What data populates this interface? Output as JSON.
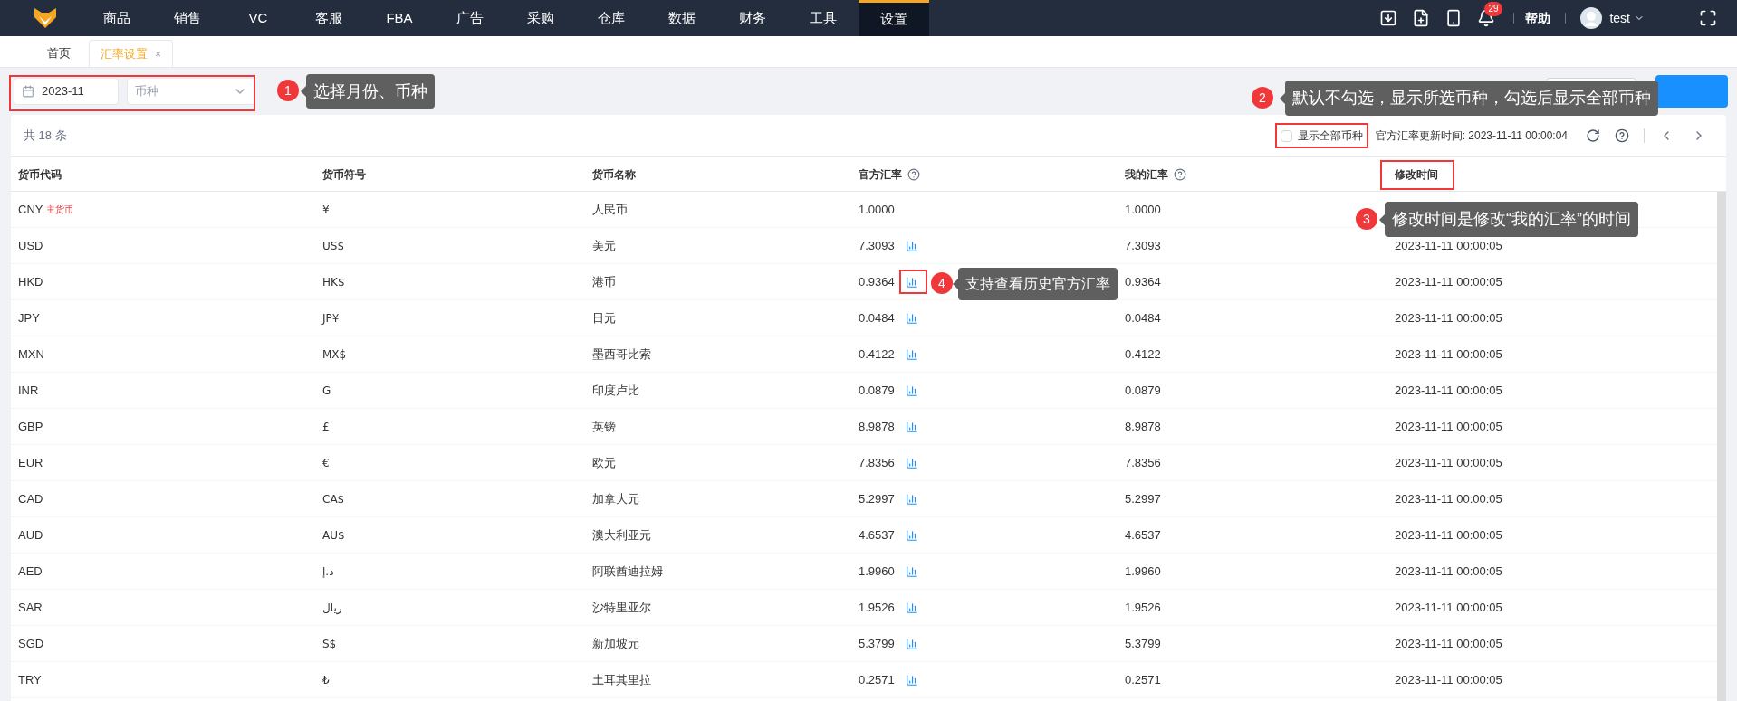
{
  "nav": {
    "items": [
      {
        "label": "商品",
        "selected": false
      },
      {
        "label": "销售",
        "selected": false
      },
      {
        "label": "VC",
        "selected": false
      },
      {
        "label": "客服",
        "selected": false
      },
      {
        "label": "FBA",
        "selected": false
      },
      {
        "label": "广告",
        "selected": false
      },
      {
        "label": "采购",
        "selected": false
      },
      {
        "label": "仓库",
        "selected": false
      },
      {
        "label": "数据",
        "selected": false
      },
      {
        "label": "财务",
        "selected": false
      },
      {
        "label": "工具",
        "selected": false
      },
      {
        "label": "设置",
        "selected": true
      }
    ],
    "badge": "29",
    "help": "帮助",
    "user": "test"
  },
  "tabs": [
    {
      "label": "首页",
      "selected": false
    },
    {
      "label": "汇率设置",
      "selected": true,
      "close": "×"
    }
  ],
  "filters": {
    "month": "2023-11",
    "currency_placeholder": "币种"
  },
  "card": {
    "total": "共 18 条",
    "show_all": {
      "label": "显示全部币种",
      "checked": false
    },
    "update_time": "官方汇率更新时间: 2023-11-11 00:00:04"
  },
  "columns": [
    {
      "label": "货币代码",
      "help": false
    },
    {
      "label": "货币符号",
      "help": false
    },
    {
      "label": "货币名称",
      "help": false
    },
    {
      "label": "官方汇率",
      "help": true
    },
    {
      "label": "我的汇率",
      "help": true
    },
    {
      "label": "修改时间",
      "help": false
    }
  ],
  "rows": [
    {
      "code": "CNY",
      "tag": "主货币",
      "symbol": "¥",
      "name": "人民币",
      "official": "1.0000",
      "chart": false,
      "mine": "1.0000"
    },
    {
      "code": "USD",
      "symbol": "US$",
      "name": "美元",
      "official": "7.3093",
      "chart": true,
      "mine": "7.3093",
      "modified": "2023-11-11 00:00:05"
    },
    {
      "code": "HKD",
      "symbol": "HK$",
      "name": "港币",
      "official": "0.9364",
      "chart": true,
      "mine": "0.9364",
      "modified": "2023-11-11 00:00:05"
    },
    {
      "code": "JPY",
      "symbol": "JP¥",
      "name": "日元",
      "official": "0.0484",
      "chart": true,
      "mine": "0.0484",
      "modified": "2023-11-11 00:00:05"
    },
    {
      "code": "MXN",
      "symbol": "MX$",
      "name": "墨西哥比索",
      "official": "0.4122",
      "chart": true,
      "mine": "0.4122",
      "modified": "2023-11-11 00:00:05"
    },
    {
      "code": "INR",
      "symbol": "G",
      "name": "印度卢比",
      "official": "0.0879",
      "chart": true,
      "mine": "0.0879",
      "modified": "2023-11-11 00:00:05"
    },
    {
      "code": "GBP",
      "symbol": "£",
      "name": "英镑",
      "official": "8.9878",
      "chart": true,
      "mine": "8.9878",
      "modified": "2023-11-11 00:00:05"
    },
    {
      "code": "EUR",
      "symbol": "€",
      "name": "欧元",
      "official": "7.8356",
      "chart": true,
      "mine": "7.8356",
      "modified": "2023-11-11 00:00:05"
    },
    {
      "code": "CAD",
      "symbol": "CA$",
      "name": "加拿大元",
      "official": "5.2997",
      "chart": true,
      "mine": "5.2997",
      "modified": "2023-11-11 00:00:05"
    },
    {
      "code": "AUD",
      "symbol": "AU$",
      "name": "澳大利亚元",
      "official": "4.6537",
      "chart": true,
      "mine": "4.6537",
      "modified": "2023-11-11 00:00:05"
    },
    {
      "code": "AED",
      "symbol": "د.إ",
      "name": "阿联酋迪拉姆",
      "official": "1.9960",
      "chart": true,
      "mine": "1.9960",
      "modified": "2023-11-11 00:00:05"
    },
    {
      "code": "SAR",
      "symbol": "ريال",
      "name": "沙特里亚尔",
      "official": "1.9526",
      "chart": true,
      "mine": "1.9526",
      "modified": "2023-11-11 00:00:05"
    },
    {
      "code": "SGD",
      "symbol": "S$",
      "name": "新加坡元",
      "official": "5.3799",
      "chart": true,
      "mine": "5.3799",
      "modified": "2023-11-11 00:00:05"
    },
    {
      "code": "TRY",
      "symbol": "₺",
      "name": "土耳其里拉",
      "official": "0.2571",
      "chart": true,
      "mine": "0.2571",
      "modified": "2023-11-11 00:00:05"
    }
  ],
  "callouts": [
    {
      "number": "1",
      "text": "选择月份、币种"
    },
    {
      "number": "2",
      "text": "默认不勾选，显示所选币种，勾选后显示全部币种"
    },
    {
      "number": "3",
      "text": "修改时间是修改“我的汇率”的时间"
    },
    {
      "number": "4",
      "text": "支持查看历史官方汇率"
    }
  ]
}
